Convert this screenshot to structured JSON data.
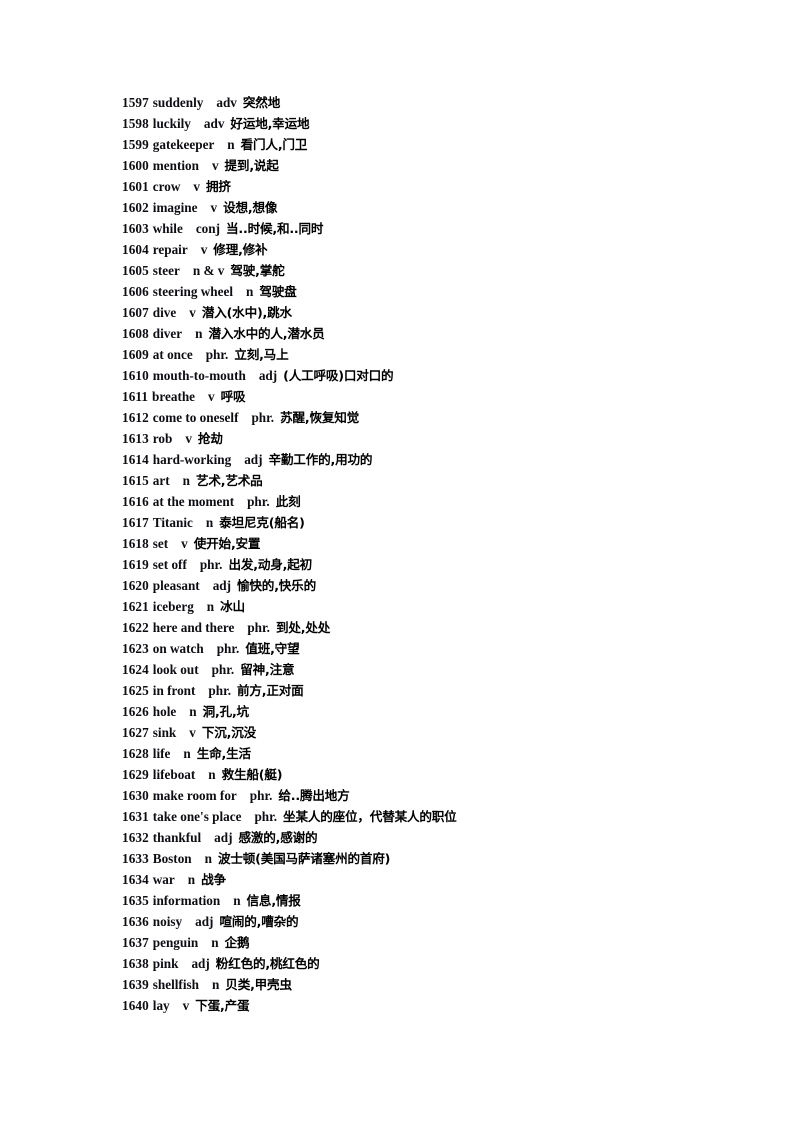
{
  "page": {
    "background_color": "#ffffff",
    "text_color": "#0d0d14"
  },
  "vocabulary": {
    "entries": [
      {
        "num": "1597",
        "word": "suddenly",
        "pos": "adv",
        "cn": "突然地"
      },
      {
        "num": "1598",
        "word": "luckily",
        "pos": "adv",
        "cn": "好运地,幸运地"
      },
      {
        "num": "1599",
        "word": "gatekeeper",
        "pos": "n",
        "cn": "看门人,门卫"
      },
      {
        "num": "1600",
        "word": "mention",
        "pos": "v",
        "cn": "提到,说起"
      },
      {
        "num": "1601",
        "word": "crow",
        "pos": "v",
        "cn": "拥挤"
      },
      {
        "num": "1602",
        "word": "imagine",
        "pos": "v",
        "cn": "设想,想像"
      },
      {
        "num": "1603",
        "word": "while",
        "pos": "conj",
        "cn": "当..时候,和..同时"
      },
      {
        "num": "1604",
        "word": "repair",
        "pos": "v",
        "cn": "修理,修补"
      },
      {
        "num": "1605",
        "word": "steer",
        "pos": "n & v",
        "cn": "驾驶,掌舵"
      },
      {
        "num": "1606",
        "word": "steering wheel",
        "pos": "n",
        "cn": "驾驶盘"
      },
      {
        "num": "1607",
        "word": "dive",
        "pos": "v",
        "cn": "潜入(水中),跳水"
      },
      {
        "num": "1608",
        "word": "diver",
        "pos": "n",
        "cn": "潜入水中的人,潜水员"
      },
      {
        "num": "1609",
        "word": "at once",
        "pos": "phr.",
        "cn": "立刻,马上"
      },
      {
        "num": "1610",
        "word": "mouth-to-mouth",
        "pos": "adj",
        "cn": "(人工呼吸)口对口的"
      },
      {
        "num": "1611",
        "word": "breathe",
        "pos": "v",
        "cn": "呼吸"
      },
      {
        "num": "1612",
        "word": "come to oneself",
        "pos": "phr.",
        "cn": "苏醒,恢复知觉"
      },
      {
        "num": "1613",
        "word": "rob",
        "pos": "v",
        "cn": "抢劫"
      },
      {
        "num": "1614",
        "word": "hard-working",
        "pos": "adj",
        "cn": "辛勤工作的,用功的"
      },
      {
        "num": "1615",
        "word": "art",
        "pos": "n",
        "cn": "艺术,艺术品"
      },
      {
        "num": "1616",
        "word": "at the moment",
        "pos": "phr.",
        "cn": "此刻"
      },
      {
        "num": "1617",
        "word": "Titanic",
        "pos": "n",
        "cn": "泰坦尼克(船名)"
      },
      {
        "num": "1618",
        "word": "set",
        "pos": "v",
        "cn": "使开始,安置"
      },
      {
        "num": "1619",
        "word": "set off",
        "pos": "phr.",
        "cn": "出发,动身,起初"
      },
      {
        "num": "1620",
        "word": "pleasant",
        "pos": "adj",
        "cn": "愉快的,快乐的"
      },
      {
        "num": "1621",
        "word": "iceberg",
        "pos": "n",
        "cn": "冰山"
      },
      {
        "num": "1622",
        "word": "here and there",
        "pos": "phr.",
        "cn": "到处,处处"
      },
      {
        "num": "1623",
        "word": "on watch",
        "pos": "phr.",
        "cn": "值班,守望"
      },
      {
        "num": "1624",
        "word": "look out",
        "pos": "phr.",
        "cn": "留神,注意"
      },
      {
        "num": "1625",
        "word": "in front",
        "pos": "phr.",
        "cn": "前方,正对面"
      },
      {
        "num": "1626",
        "word": "hole",
        "pos": "n",
        "cn": "洞,孔,坑"
      },
      {
        "num": "1627",
        "word": "sink",
        "pos": "v",
        "cn": "下沉,沉没"
      },
      {
        "num": "1628",
        "word": "life",
        "pos": "n",
        "cn": "生命,生活"
      },
      {
        "num": "1629",
        "word": "lifeboat",
        "pos": "n",
        "cn": "救生船(艇)"
      },
      {
        "num": "1630",
        "word": "make room for",
        "pos": "phr.",
        "cn": "给..腾出地方"
      },
      {
        "num": "1631",
        "word": "take one's place",
        "pos": "phr.",
        "cn": "坐某人的座位，代替某人的职位"
      },
      {
        "num": "1632",
        "word": "thankful",
        "pos": "adj",
        "cn": "感激的,感谢的"
      },
      {
        "num": "1633",
        "word": "Boston",
        "pos": "n",
        "cn": "波士顿(美国马萨诸塞州的首府)"
      },
      {
        "num": "1634",
        "word": "war",
        "pos": "n",
        "cn": "战争"
      },
      {
        "num": "1635",
        "word": "information",
        "pos": "n",
        "cn": "信息,情报"
      },
      {
        "num": "1636",
        "word": "noisy",
        "pos": "adj",
        "cn": "喧闹的,嘈杂的"
      },
      {
        "num": "1637",
        "word": "penguin",
        "pos": "n",
        "cn": "企鹅"
      },
      {
        "num": "1638",
        "word": "pink",
        "pos": "adj",
        "cn": "粉红色的,桃红色的"
      },
      {
        "num": "1639",
        "word": "shellfish",
        "pos": "n",
        "cn": "贝类,甲壳虫"
      },
      {
        "num": "1640",
        "word": "lay",
        "pos": "v",
        "cn": "下蛋,产蛋"
      }
    ]
  }
}
